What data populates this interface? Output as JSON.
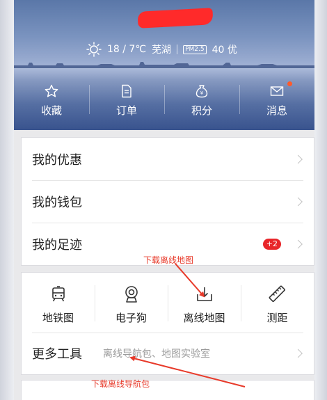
{
  "weather": {
    "temperature": "18 / 7℃",
    "city": "芜湖",
    "pm_label": "PM2.5",
    "aqi": "40 优"
  },
  "quick_actions": [
    {
      "label": "收藏",
      "icon": "star-icon"
    },
    {
      "label": "订单",
      "icon": "document-icon"
    },
    {
      "label": "积分",
      "icon": "money-bag-icon"
    },
    {
      "label": "消息",
      "icon": "envelope-icon"
    }
  ],
  "menu": [
    {
      "label": "我的优惠"
    },
    {
      "label": "我的钱包"
    },
    {
      "label": "我的足迹",
      "badge": "+2"
    }
  ],
  "tools": [
    {
      "label": "地铁图",
      "icon": "subway-icon"
    },
    {
      "label": "电子狗",
      "icon": "camera-icon"
    },
    {
      "label": "离线地图",
      "icon": "download-tray-icon"
    },
    {
      "label": "测距",
      "icon": "ruler-icon"
    }
  ],
  "more_tools": {
    "label": "更多工具",
    "subtitle": "离线导航包、地图实验室"
  },
  "annotations": {
    "top": "下载离线地图",
    "bottom": "下载离线导航包"
  },
  "colors": {
    "accent_red": "#e83a2a",
    "badge_red": "#e8262a",
    "hero_blue": "#5a77a8"
  }
}
